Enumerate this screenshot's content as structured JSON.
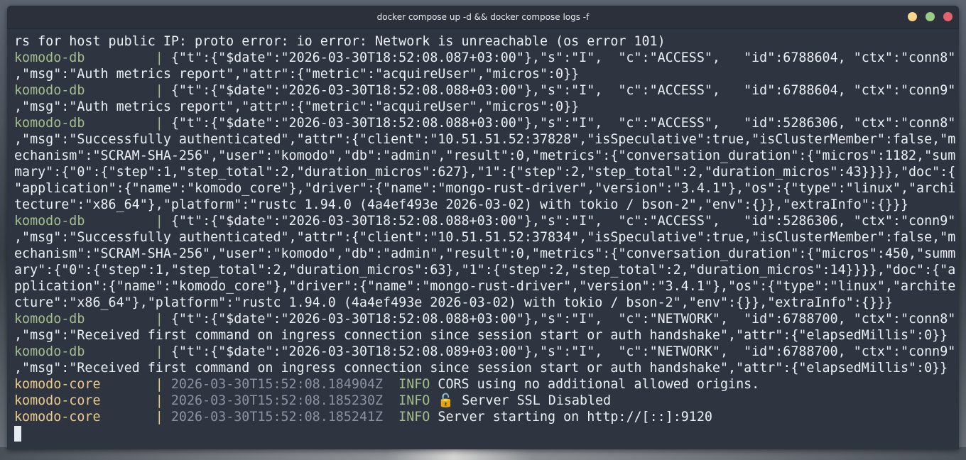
{
  "window": {
    "title": "docker compose up -d && docker compose logs -f"
  },
  "colors": {
    "terminal_bg": "#2e3440",
    "service_db": "#a3be8c",
    "service_core": "#ebcb8b",
    "text": "#eceff4",
    "timestamp": "#8c93a0"
  },
  "terminal": {
    "lines": [
      {
        "text": "rs for host public IP: proto error: io error: Network is unreachable (os error 101)"
      },
      {
        "svc": "komodo-db",
        "pipe": "|",
        "text": "{\"t\":{\"$date\":\"2026-03-30T18:52:08.087+03:00\"},\"s\":\"I\",  \"c\":\"ACCESS\",   \"id\":6788604, \"ctx\":\"conn8\""
      },
      {
        "text": ",\"msg\":\"Auth metrics report\",\"attr\":{\"metric\":\"acquireUser\",\"micros\":0}}"
      },
      {
        "svc": "komodo-db",
        "pipe": "|",
        "text": "{\"t\":{\"$date\":\"2026-03-30T18:52:08.088+03:00\"},\"s\":\"I\",  \"c\":\"ACCESS\",   \"id\":6788604, \"ctx\":\"conn9\""
      },
      {
        "text": ",\"msg\":\"Auth metrics report\",\"attr\":{\"metric\":\"acquireUser\",\"micros\":0}}"
      },
      {
        "svc": "komodo-db",
        "pipe": "|",
        "text": "{\"t\":{\"$date\":\"2026-03-30T18:52:08.088+03:00\"},\"s\":\"I\",  \"c\":\"ACCESS\",   \"id\":5286306, \"ctx\":\"conn8\""
      },
      {
        "text": ",\"msg\":\"Successfully authenticated\",\"attr\":{\"client\":\"10.51.51.52:37828\",\"isSpeculative\":true,\"isClusterMember\":false,\"m"
      },
      {
        "text": "echanism\":\"SCRAM-SHA-256\",\"user\":\"komodo\",\"db\":\"admin\",\"result\":0,\"metrics\":{\"conversation_duration\":{\"micros\":1182,\"sum"
      },
      {
        "text": "mary\":{\"0\":{\"step\":1,\"step_total\":2,\"duration_micros\":627},\"1\":{\"step\":2,\"step_total\":2,\"duration_micros\":43}}}},\"doc\":{"
      },
      {
        "text": "\"application\":{\"name\":\"komodo_core\"},\"driver\":{\"name\":\"mongo-rust-driver\",\"version\":\"3.4.1\"},\"os\":{\"type\":\"linux\",\"archi"
      },
      {
        "text": "tecture\":\"x86_64\"},\"platform\":\"rustc 1.94.0 (4a4ef493e 2026-03-02) with tokio / bson-2\",\"env\":{}},\"extraInfo\":{}}}"
      },
      {
        "svc": "komodo-db",
        "pipe": "|",
        "text": "{\"t\":{\"$date\":\"2026-03-30T18:52:08.088+03:00\"},\"s\":\"I\",  \"c\":\"ACCESS\",   \"id\":5286306, \"ctx\":\"conn9\""
      },
      {
        "text": ",\"msg\":\"Successfully authenticated\",\"attr\":{\"client\":\"10.51.51.52:37834\",\"isSpeculative\":true,\"isClusterMember\":false,\"m"
      },
      {
        "text": "echanism\":\"SCRAM-SHA-256\",\"user\":\"komodo\",\"db\":\"admin\",\"result\":0,\"metrics\":{\"conversation_duration\":{\"micros\":450,\"summ"
      },
      {
        "text": "ary\":{\"0\":{\"step\":1,\"step_total\":2,\"duration_micros\":63},\"1\":{\"step\":2,\"step_total\":2,\"duration_micros\":14}}}},\"doc\":{\"a"
      },
      {
        "text": "pplication\":{\"name\":\"komodo_core\"},\"driver\":{\"name\":\"mongo-rust-driver\",\"version\":\"3.4.1\"},\"os\":{\"type\":\"linux\",\"archite"
      },
      {
        "text": "cture\":\"x86_64\"},\"platform\":\"rustc 1.94.0 (4a4ef493e 2026-03-02) with tokio / bson-2\",\"env\":{}},\"extraInfo\":{}}}"
      },
      {
        "svc": "komodo-db",
        "pipe": "|",
        "text": "{\"t\":{\"$date\":\"2026-03-30T18:52:08.088+03:00\"},\"s\":\"I\",  \"c\":\"NETWORK\",  \"id\":6788700, \"ctx\":\"conn8\""
      },
      {
        "text": ",\"msg\":\"Received first command on ingress connection since session start or auth handshake\",\"attr\":{\"elapsedMillis\":0}}"
      },
      {
        "svc": "komodo-db",
        "pipe": "|",
        "text": "{\"t\":{\"$date\":\"2026-03-30T18:52:08.089+03:00\"},\"s\":\"I\",  \"c\":\"NETWORK\",  \"id\":6788700, \"ctx\":\"conn9\""
      },
      {
        "text": ",\"msg\":\"Received first command on ingress connection since session start or auth handshake\",\"attr\":{\"elapsedMillis\":0}}"
      },
      {
        "svc": "komodo-core",
        "pipe": "|",
        "ts": "2026-03-30T15:52:08.184904Z",
        "level": "INFO",
        "text": "CORS using no additional allowed origins."
      },
      {
        "svc": "komodo-core",
        "pipe": "|",
        "ts": "2026-03-30T15:52:08.185230Z",
        "level": "INFO",
        "icon": "🔓",
        "text": "Server SSL Disabled"
      },
      {
        "svc": "komodo-core",
        "pipe": "|",
        "ts": "2026-03-30T15:52:08.185241Z",
        "level": "INFO",
        "text": "Server starting on http://[::]:9120"
      }
    ]
  }
}
